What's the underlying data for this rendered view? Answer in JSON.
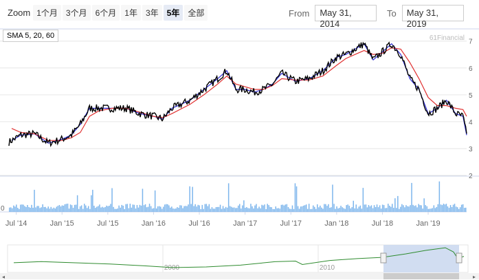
{
  "toolbar": {
    "zoom_label": "Zoom",
    "zoom_buttons": [
      "1个月",
      "3个月",
      "6个月",
      "1年",
      "3年",
      "5年",
      "全部"
    ],
    "active_zoom": "5年",
    "from_label": "From",
    "from_value": "May 31, 2014",
    "to_label": "To",
    "to_value": "May 31, 2019"
  },
  "legend_text": "SMA 5, 20, 60",
  "watermark": "61Financial",
  "colors": {
    "price": "#000000",
    "sma5": "#2b2bd6",
    "sma20": "#e03030",
    "volume": "#7cb5ec",
    "navigator": "#2e8b2e",
    "nav_mask": "#c9d7ef"
  },
  "chart_data": {
    "type": "line",
    "x_ticks": [
      "Jul '14",
      "Jan '15",
      "Jul '15",
      "Jan '16",
      "Jul '16",
      "Jan '17",
      "Jul '17",
      "Jan '18",
      "Jul '18",
      "Jan '19"
    ],
    "y_ticks": [
      "2",
      "3",
      "4",
      "5",
      "6",
      "7"
    ],
    "ylim": [
      2,
      7.3
    ],
    "volume_ticks": [
      "0"
    ],
    "navigator_ticks": [
      "2000",
      "2010"
    ],
    "grid": true,
    "series": [
      {
        "name": "SMA 5",
        "values": [
          [
            2014.45,
            3.3
          ],
          [
            2014.55,
            3.5
          ],
          [
            2014.7,
            3.55
          ],
          [
            2014.85,
            3.2
          ],
          [
            2015.0,
            3.35
          ],
          [
            2015.1,
            3.5
          ],
          [
            2015.2,
            3.9
          ],
          [
            2015.3,
            4.5
          ],
          [
            2015.4,
            4.5
          ],
          [
            2015.55,
            4.5
          ],
          [
            2015.7,
            4.5
          ],
          [
            2015.85,
            4.3
          ],
          [
            2016.0,
            4.2
          ],
          [
            2016.1,
            4.1
          ],
          [
            2016.2,
            4.5
          ],
          [
            2016.4,
            4.8
          ],
          [
            2016.55,
            5.2
          ],
          [
            2016.7,
            5.6
          ],
          [
            2016.8,
            5.9
          ],
          [
            2016.9,
            5.2
          ],
          [
            2017.0,
            5.2
          ],
          [
            2017.1,
            5.1
          ],
          [
            2017.2,
            5.2
          ],
          [
            2017.3,
            5.4
          ],
          [
            2017.4,
            5.8
          ],
          [
            2017.55,
            5.5
          ],
          [
            2017.7,
            5.6
          ],
          [
            2017.85,
            5.9
          ],
          [
            2018.0,
            6.4
          ],
          [
            2018.1,
            6.5
          ],
          [
            2018.2,
            6.7
          ],
          [
            2018.3,
            6.9
          ],
          [
            2018.4,
            6.3
          ],
          [
            2018.5,
            6.6
          ],
          [
            2018.6,
            6.9
          ],
          [
            2018.7,
            6.5
          ],
          [
            2018.8,
            5.6
          ],
          [
            2018.9,
            5.2
          ],
          [
            2019.0,
            4.3
          ],
          [
            2019.1,
            4.5
          ],
          [
            2019.2,
            4.8
          ],
          [
            2019.3,
            4.3
          ],
          [
            2019.38,
            4.2
          ],
          [
            2019.42,
            3.5
          ]
        ]
      },
      {
        "name": "SMA 20",
        "values": [
          [
            2014.45,
            3.75
          ],
          [
            2014.55,
            3.6
          ],
          [
            2014.7,
            3.55
          ],
          [
            2014.85,
            3.3
          ],
          [
            2015.0,
            3.3
          ],
          [
            2015.1,
            3.4
          ],
          [
            2015.2,
            3.6
          ],
          [
            2015.3,
            4.2
          ],
          [
            2015.4,
            4.4
          ],
          [
            2015.55,
            4.5
          ],
          [
            2015.7,
            4.5
          ],
          [
            2015.85,
            4.35
          ],
          [
            2016.0,
            4.2
          ],
          [
            2016.1,
            4.15
          ],
          [
            2016.2,
            4.3
          ],
          [
            2016.4,
            4.65
          ],
          [
            2016.55,
            5.0
          ],
          [
            2016.7,
            5.4
          ],
          [
            2016.8,
            5.7
          ],
          [
            2016.9,
            5.4
          ],
          [
            2017.0,
            5.3
          ],
          [
            2017.1,
            5.2
          ],
          [
            2017.2,
            5.2
          ],
          [
            2017.3,
            5.35
          ],
          [
            2017.4,
            5.6
          ],
          [
            2017.55,
            5.55
          ],
          [
            2017.7,
            5.55
          ],
          [
            2017.85,
            5.7
          ],
          [
            2018.0,
            6.1
          ],
          [
            2018.1,
            6.35
          ],
          [
            2018.2,
            6.5
          ],
          [
            2018.3,
            6.65
          ],
          [
            2018.4,
            6.5
          ],
          [
            2018.5,
            6.55
          ],
          [
            2018.6,
            6.75
          ],
          [
            2018.7,
            6.7
          ],
          [
            2018.8,
            6.2
          ],
          [
            2018.9,
            5.6
          ],
          [
            2019.0,
            4.9
          ],
          [
            2019.1,
            4.6
          ],
          [
            2019.2,
            4.6
          ],
          [
            2019.3,
            4.5
          ],
          [
            2019.38,
            4.45
          ],
          [
            2019.42,
            4.2
          ]
        ]
      }
    ]
  }
}
